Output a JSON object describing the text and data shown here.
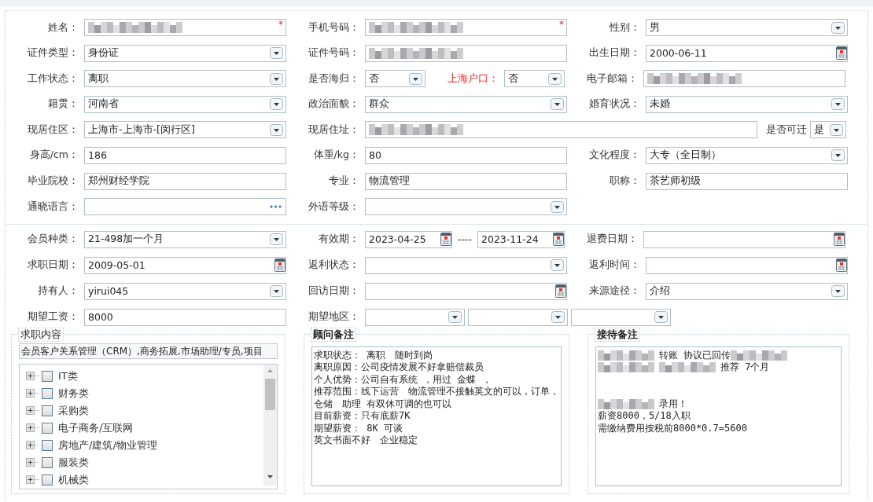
{
  "section_1": {
    "rows": [
      {
        "cells": [
          {
            "label": "姓名：",
            "kind": "normal",
            "controls": [
              {
                "kind": "text",
                "redacted": true,
                "required_mark": "*"
              }
            ]
          },
          {
            "label": "手机号码：",
            "kind": "normal",
            "controls": [
              {
                "kind": "text",
                "redacted": true,
                "required_mark": "*"
              }
            ]
          },
          {
            "label": "性别：",
            "kind": "normal",
            "controls": [
              {
                "kind": "select",
                "value": "男"
              }
            ]
          }
        ]
      },
      {
        "cells": [
          {
            "label": "证件类型：",
            "kind": "normal",
            "controls": [
              {
                "kind": "select",
                "value": "身份证"
              }
            ]
          },
          {
            "label": "证件号码：",
            "kind": "normal",
            "controls": [
              {
                "kind": "text",
                "redacted": true
              }
            ]
          },
          {
            "label": "出生日期：",
            "kind": "normal",
            "controls": [
              {
                "kind": "date",
                "value": "2000-06-11"
              }
            ]
          }
        ]
      },
      {
        "cells": [
          {
            "label": "工作状态：",
            "kind": "normal",
            "controls": [
              {
                "kind": "select",
                "value": "离职"
              }
            ]
          },
          {
            "label": "是否海归：",
            "kind": "half",
            "controls": [
              {
                "kind": "select",
                "value": "否"
              }
            ]
          },
          {
            "label": "上海户口：",
            "kind": "half",
            "emphasis": true,
            "controls": [
              {
                "kind": "select",
                "value": "否"
              }
            ]
          },
          {
            "label": "电子邮箱：",
            "kind": "normal",
            "controls": [
              {
                "kind": "text",
                "redacted": true
              }
            ]
          }
        ]
      },
      {
        "cells": [
          {
            "label": "籍贯：",
            "kind": "normal",
            "controls": [
              {
                "kind": "select",
                "value": "河南省"
              }
            ]
          },
          {
            "label": "政治面貌：",
            "kind": "normal",
            "controls": [
              {
                "kind": "select",
                "value": "群众"
              }
            ]
          },
          {
            "label": "婚育状况：",
            "kind": "normal",
            "controls": [
              {
                "kind": "select",
                "value": "未婚"
              }
            ]
          }
        ]
      },
      {
        "cells": [
          {
            "label": "现居住区：",
            "kind": "normal",
            "controls": [
              {
                "kind": "select",
                "value": "上海市-上海市-[闵行区]"
              }
            ]
          },
          {
            "label": "现居住址：",
            "kind": "wide",
            "controls": [
              {
                "kind": "text",
                "redacted": true
              }
            ]
          },
          {
            "label": "是否可迁",
            "kind": "tiny",
            "controls": [
              {
                "kind": "select",
                "value": "是"
              }
            ]
          }
        ]
      },
      {
        "cells": [
          {
            "label": "身高/cm：",
            "kind": "normal",
            "controls": [
              {
                "kind": "text",
                "value": "186"
              }
            ]
          },
          {
            "label": "体重/kg：",
            "kind": "normal",
            "controls": [
              {
                "kind": "text",
                "value": "80"
              }
            ]
          },
          {
            "label": "文化程度：",
            "kind": "normal",
            "controls": [
              {
                "kind": "select",
                "value": "大专（全日制）"
              }
            ]
          }
        ]
      },
      {
        "cells": [
          {
            "label": "毕业院校：",
            "kind": "normal",
            "controls": [
              {
                "kind": "text",
                "value": "郑州财经学院"
              }
            ]
          },
          {
            "label": "专业：",
            "kind": "normal",
            "controls": [
              {
                "kind": "text",
                "value": "物流管理"
              }
            ]
          },
          {
            "label": "职称：",
            "kind": "normal",
            "controls": [
              {
                "kind": "text",
                "value": "茶艺师初级"
              }
            ]
          }
        ]
      },
      {
        "cells": [
          {
            "label": "通晓语言：",
            "kind": "normal",
            "controls": [
              {
                "kind": "more"
              }
            ]
          },
          {
            "label": "外语等级：",
            "kind": "normal",
            "controls": [
              {
                "kind": "select"
              }
            ]
          }
        ]
      }
    ]
  },
  "section_2": {
    "rows": [
      {
        "cells": [
          {
            "label": "会员种类：",
            "kind": "normal",
            "controls": [
              {
                "kind": "select",
                "value": "21-498加一个月"
              }
            ]
          },
          {
            "label": "有效期：",
            "kind": "range",
            "separator": "----",
            "controls": [
              {
                "kind": "date",
                "value": "2023-04-25"
              },
              {
                "kind": "date",
                "value": "2023-11-24"
              }
            ]
          },
          {
            "label": "退费日期：",
            "kind": "normal",
            "controls": [
              {
                "kind": "date"
              }
            ]
          }
        ]
      },
      {
        "cells": [
          {
            "label": "求职日期：",
            "kind": "normal",
            "controls": [
              {
                "kind": "date",
                "value": "2009-05-01"
              }
            ]
          },
          {
            "label": "返利状态：",
            "kind": "normal",
            "controls": [
              {
                "kind": "select"
              }
            ]
          },
          {
            "label": "返利时间：",
            "kind": "normal",
            "controls": [
              {
                "kind": "date"
              }
            ]
          }
        ]
      },
      {
        "cells": [
          {
            "label": "持有人：",
            "kind": "normal",
            "controls": [
              {
                "kind": "select",
                "value": "yirui045"
              }
            ]
          },
          {
            "label": "回访日期：",
            "kind": "normal",
            "controls": [
              {
                "kind": "date"
              }
            ]
          },
          {
            "label": "来源途径：",
            "kind": "normal",
            "controls": [
              {
                "kind": "select",
                "value": "介绍"
              }
            ]
          }
        ]
      },
      {
        "cells": [
          {
            "label": "期望工资：",
            "kind": "normal",
            "controls": [
              {
                "kind": "text",
                "value": "8000"
              }
            ]
          },
          {
            "label": "期望地区：",
            "kind": "region",
            "controls": [
              {
                "kind": "select"
              },
              {
                "kind": "select"
              },
              {
                "kind": "select"
              }
            ]
          }
        ]
      }
    ]
  },
  "job_content": {
    "title": "求职内容",
    "value": "会员客户关系管理（CRM）,商务拓展,市场助理/专员,项目",
    "tree": [
      {
        "label": "IT类",
        "checked": false,
        "expanded": false
      },
      {
        "label": "财务类",
        "checked": false,
        "expanded": false
      },
      {
        "label": "采购类",
        "checked": false,
        "expanded": false
      },
      {
        "label": "电子商务/互联网",
        "checked": false,
        "expanded": false
      },
      {
        "label": "房地产/建筑/物业管理",
        "checked": false,
        "expanded": false
      },
      {
        "label": "服装类",
        "checked": false,
        "expanded": false
      },
      {
        "label": "机械类",
        "checked": false,
        "expanded": false
      }
    ]
  },
  "consultant_notes": {
    "title": "顾问备注",
    "lines": [
      {
        "kind": "text",
        "segments": [
          {
            "kind": "text",
            "text": "求职状态： 离职　随时到岗"
          }
        ]
      },
      {
        "kind": "text",
        "segments": [
          {
            "kind": "text",
            "text": "离职原因：公司疫情发展不好拿赔偿裁员"
          }
        ]
      },
      {
        "kind": "text",
        "segments": [
          {
            "kind": "text",
            "text": "个人优势：公司自有系统 ，用过 金蝶 ，"
          }
        ]
      },
      {
        "kind": "text",
        "segments": [
          {
            "kind": "text",
            "text": "推荐范围：线下运营　物流管理不接触英文的可以，订单，仓储　助理 有双休可调的也可以"
          }
        ]
      },
      {
        "kind": "text",
        "segments": [
          {
            "kind": "text",
            "text": "目前薪资：只有底薪7K"
          }
        ]
      },
      {
        "kind": "text",
        "segments": [
          {
            "kind": "text",
            "text": "期望薪资： 8K 可谈"
          }
        ]
      },
      {
        "kind": "text",
        "segments": [
          {
            "kind": "text",
            "text": "英文书面不好　企业稳定"
          }
        ]
      }
    ]
  },
  "reception_notes": {
    "title": "接待备注",
    "lines": [
      {
        "kind": "text",
        "segments": [
          {
            "kind": "blur"
          },
          {
            "kind": "text",
            "text": "转账 协议已回传"
          },
          {
            "kind": "blur"
          }
        ]
      },
      {
        "kind": "text",
        "segments": [
          {
            "kind": "blur"
          },
          {
            "kind": "blur"
          },
          {
            "kind": "text",
            "text": "推荐 7个月"
          }
        ]
      },
      {
        "kind": "gap"
      },
      {
        "kind": "gap"
      },
      {
        "kind": "text",
        "segments": [
          {
            "kind": "blur"
          },
          {
            "kind": "text",
            "text": "录用！"
          }
        ]
      },
      {
        "kind": "text",
        "segments": [
          {
            "kind": "text",
            "text": "薪资8000，5/18入职"
          }
        ]
      },
      {
        "kind": "text",
        "segments": [
          {
            "kind": "text",
            "text": "需缴纳费用按税前8000*0.7=5600"
          }
        ]
      }
    ]
  }
}
